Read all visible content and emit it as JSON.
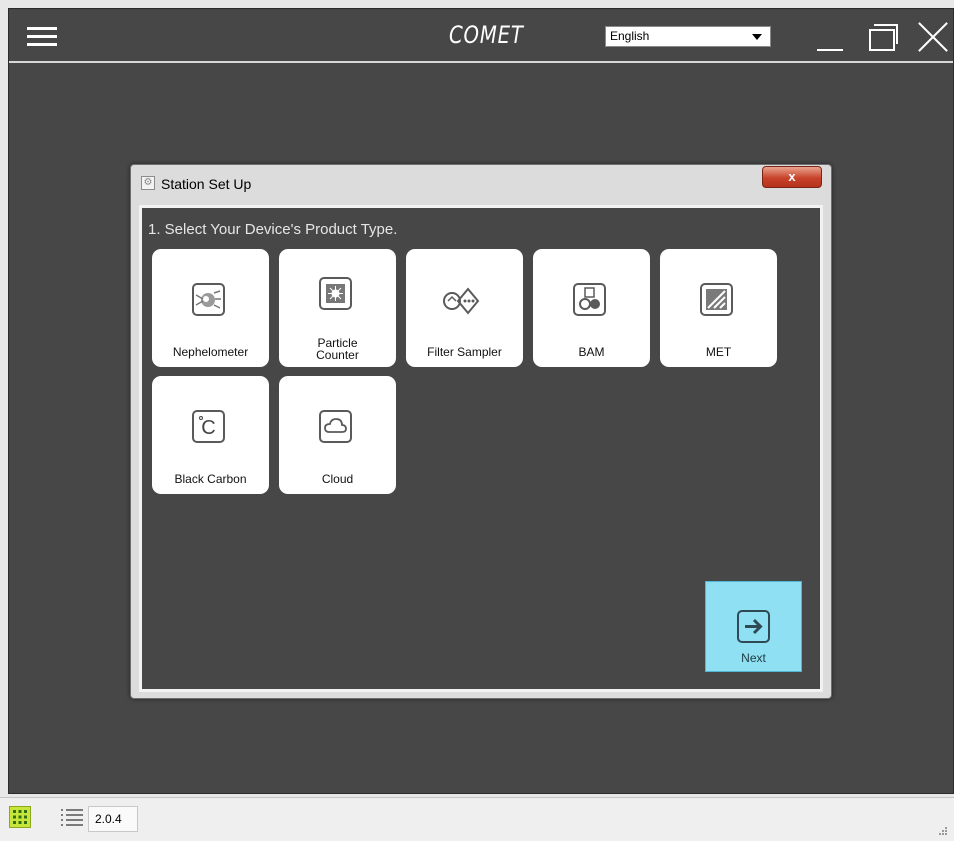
{
  "titlebar": {
    "brand": "COMET",
    "language_selected": "English"
  },
  "dialog": {
    "title": "Station Set Up",
    "close_label": "x",
    "prompt": "1. Select Your Device's Product Type.",
    "tiles": [
      {
        "label": "Nephelometer",
        "icon": "nephelometer-icon"
      },
      {
        "label": "Particle\nCounter",
        "icon": "particle-counter-icon"
      },
      {
        "label": "Filter Sampler",
        "icon": "filter-sampler-icon"
      },
      {
        "label": "BAM",
        "icon": "bam-icon"
      },
      {
        "label": "MET",
        "icon": "met-icon"
      },
      {
        "label": "Black Carbon",
        "icon": "black-carbon-icon"
      },
      {
        "label": "Cloud",
        "icon": "cloud-icon"
      }
    ],
    "next_label": "Next"
  },
  "statusbar": {
    "version": "2.0.4"
  },
  "colors": {
    "background": "#474747",
    "tile": "#ffffff",
    "next_button": "#8fe0f2",
    "grid_button": "#c8e53a",
    "close_button": "#c8432a"
  }
}
